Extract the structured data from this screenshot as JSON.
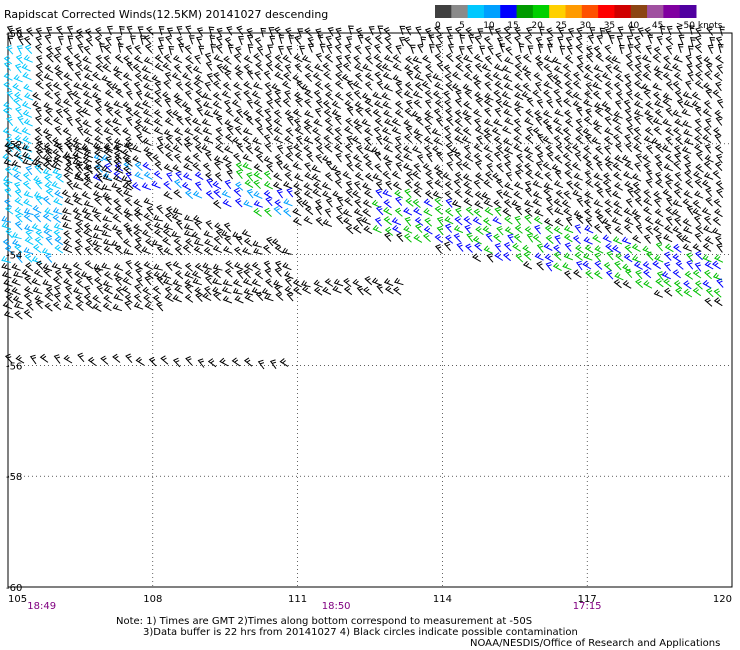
{
  "title": "Rapidscat Corrected Winds(12.5KM) 20141027 descending",
  "legend": {
    "colors": [
      "#404040",
      "#8a8a8a",
      "#00c8ff",
      "#00a0ff",
      "#0000ff",
      "#009a00",
      "#00d000",
      "#ffd000",
      "#ff9a00",
      "#ff5000",
      "#ff0000",
      "#d00000",
      "#8b4513",
      "#a050a0",
      "#8000a0",
      "#5000a0"
    ],
    "labels": [
      "0",
      "5",
      "10",
      "15",
      "20",
      "25",
      "30",
      "35",
      "40",
      "45",
      ">50 knots"
    ]
  },
  "map": {
    "lon_labels": [
      "105",
      "108",
      "111",
      "114",
      "117",
      "120"
    ],
    "lat_labels": [
      "-50",
      "-52",
      "-54",
      "-56",
      "-58",
      "-60"
    ],
    "lon_range": [
      105,
      120
    ],
    "lat_range": [
      -50,
      -60
    ],
    "time_labels": [
      {
        "text": "18:49",
        "lon": 105.4
      },
      {
        "text": "18:50",
        "lon": 111.5
      },
      {
        "text": "17:15",
        "lon": 116.7
      }
    ],
    "time_color": "#800080",
    "grid": "dotted"
  },
  "notes": {
    "line1": "Note: 1) Times are GMT 2)Times along bottom correspond to measurement at -50S",
    "line2": "3)Data buffer is 22 hrs from 20141027 4) Black circles indicate possible contamination",
    "line3": "NOAA/NESDIS/Office of Research and Applications"
  },
  "wind_colors": {
    "black": "#000000",
    "cyan": "#00c8ff",
    "lightblue": "#00a0ff",
    "blue": "#0000ff",
    "green": "#00c000"
  }
}
